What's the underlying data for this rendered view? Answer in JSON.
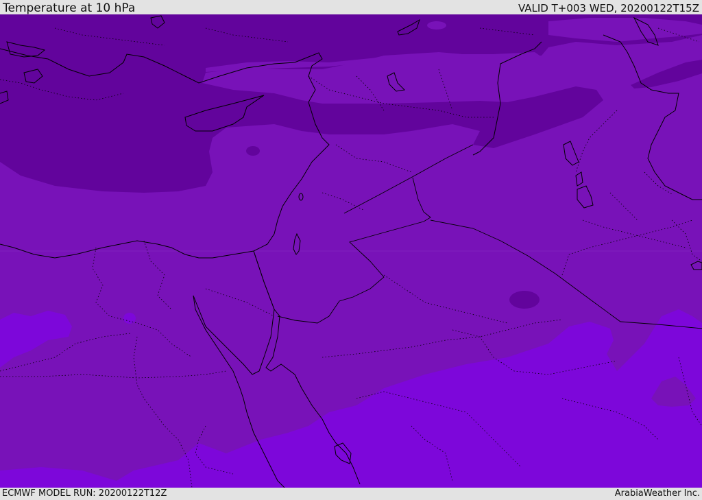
{
  "header": {
    "title": "Temperature at 10 hPa",
    "valid": "VALID T+003 WED, 20200122T15Z"
  },
  "footer": {
    "model_run": "ECMWF MODEL RUN: 20200122T12Z",
    "credit": "ArabiaWeather Inc."
  },
  "map": {
    "colors": {
      "base": "#7812b8",
      "cold": "#62049c",
      "warm": "#7d07da",
      "coastline": "#000000",
      "borders": "#000000"
    }
  }
}
